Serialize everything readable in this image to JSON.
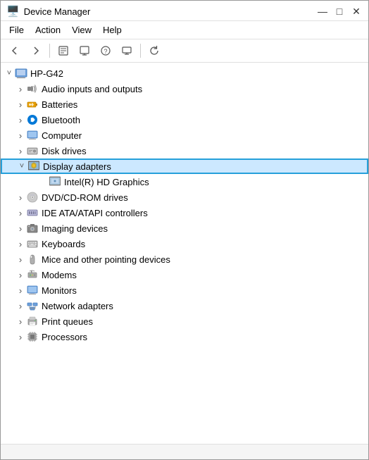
{
  "window": {
    "title": "Device Manager",
    "icon": "🖥️"
  },
  "titlebar": {
    "minimize": "—",
    "maximize": "□",
    "close": "✕"
  },
  "menu": {
    "items": [
      "File",
      "Action",
      "View",
      "Help"
    ]
  },
  "toolbar": {
    "buttons": [
      "◀",
      "▶",
      "📋",
      "📄",
      "❓",
      "📊",
      "🔄"
    ]
  },
  "tree": {
    "root": {
      "label": "HP-G42",
      "icon": "🖥️"
    },
    "items": [
      {
        "id": "audio",
        "label": "Audio inputs and outputs",
        "icon": "🔊",
        "indent": 1,
        "expanded": false,
        "hasChildren": true
      },
      {
        "id": "batteries",
        "label": "Batteries",
        "icon": "🔋",
        "indent": 1,
        "expanded": false,
        "hasChildren": true
      },
      {
        "id": "bluetooth",
        "label": "Bluetooth",
        "icon": "🔵",
        "indent": 1,
        "expanded": false,
        "hasChildren": true
      },
      {
        "id": "computer",
        "label": "Computer",
        "icon": "💻",
        "indent": 1,
        "expanded": false,
        "hasChildren": true
      },
      {
        "id": "disk",
        "label": "Disk drives",
        "icon": "💾",
        "indent": 1,
        "expanded": false,
        "hasChildren": true
      },
      {
        "id": "display",
        "label": "Display adapters",
        "icon": "🖥",
        "indent": 1,
        "expanded": true,
        "hasChildren": true,
        "selected": true
      },
      {
        "id": "intel",
        "label": "Intel(R) HD Graphics",
        "icon": "📺",
        "indent": 2,
        "expanded": false,
        "hasChildren": false
      },
      {
        "id": "dvd",
        "label": "DVD/CD-ROM drives",
        "icon": "💿",
        "indent": 1,
        "expanded": false,
        "hasChildren": true
      },
      {
        "id": "ide",
        "label": "IDE ATA/ATAPI controllers",
        "icon": "🗂",
        "indent": 1,
        "expanded": false,
        "hasChildren": true
      },
      {
        "id": "imaging",
        "label": "Imaging devices",
        "icon": "📷",
        "indent": 1,
        "expanded": false,
        "hasChildren": true
      },
      {
        "id": "keyboard",
        "label": "Keyboards",
        "icon": "⌨",
        "indent": 1,
        "expanded": false,
        "hasChildren": true
      },
      {
        "id": "mice",
        "label": "Mice and other pointing devices",
        "icon": "🖱",
        "indent": 1,
        "expanded": false,
        "hasChildren": true
      },
      {
        "id": "modems",
        "label": "Modems",
        "icon": "📡",
        "indent": 1,
        "expanded": false,
        "hasChildren": true
      },
      {
        "id": "monitors",
        "label": "Monitors",
        "icon": "🖥",
        "indent": 1,
        "expanded": false,
        "hasChildren": true
      },
      {
        "id": "network",
        "label": "Network adapters",
        "icon": "🌐",
        "indent": 1,
        "expanded": false,
        "hasChildren": true
      },
      {
        "id": "print",
        "label": "Print queues",
        "icon": "🖨",
        "indent": 1,
        "expanded": false,
        "hasChildren": true
      },
      {
        "id": "processors",
        "label": "Processors",
        "icon": "⚙",
        "indent": 1,
        "expanded": false,
        "hasChildren": true
      }
    ]
  },
  "statusbar": {
    "text": ""
  },
  "icons": {
    "computer": "🖥️",
    "audio": "🔊",
    "battery": "🔋",
    "bluetooth": "🔵",
    "disk": "💾",
    "display": "🖥",
    "dvd": "💿",
    "ide": "🗂",
    "imaging": "📷",
    "keyboard": "⌨",
    "mice": "🖱",
    "modem": "📡",
    "monitor": "🖥",
    "network": "🌐",
    "print": "🖨",
    "processor": "⚙",
    "intel": "📺"
  }
}
